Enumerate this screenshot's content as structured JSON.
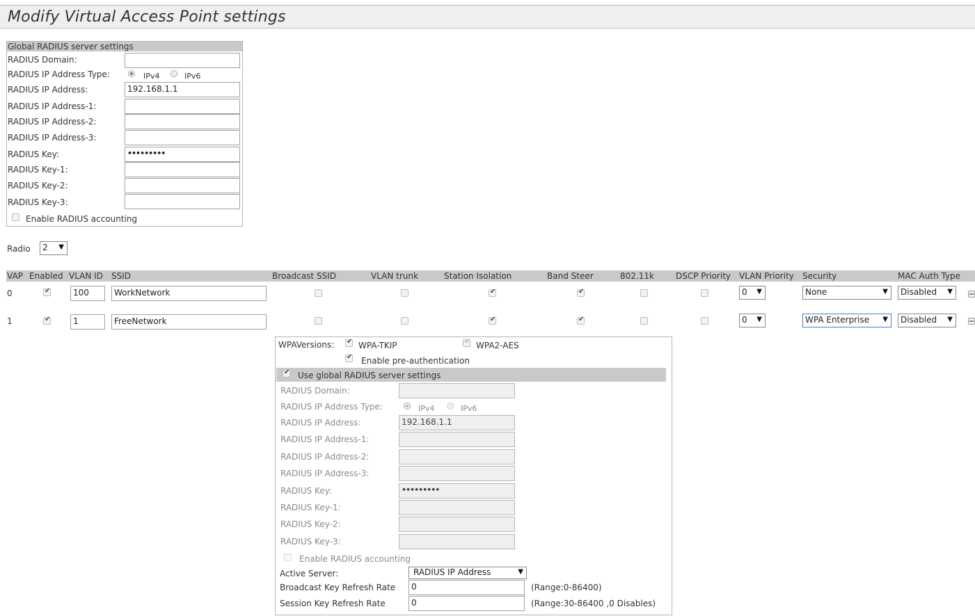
{
  "page": {
    "title": "Modify Virtual Access Point settings"
  },
  "global": {
    "header": "Global RADIUS server settings",
    "domain_label": "RADIUS Domain:",
    "domain_value": "",
    "ip_type_label": "RADIUS IP Address Type:",
    "ipv4": "IPv4",
    "ipv6": "IPv6",
    "ip_type_selected": "IPv4",
    "ip_label": "RADIUS IP Address:",
    "ip_value": "192.168.1.1",
    "ip1_label": "RADIUS IP Address-1:",
    "ip2_label": "RADIUS IP Address-2:",
    "ip3_label": "RADIUS IP Address-3:",
    "key_label": "RADIUS Key:",
    "key_value": "•••••••••",
    "key1_label": "RADIUS Key-1:",
    "key2_label": "RADIUS Key-2:",
    "key3_label": "RADIUS Key-3:",
    "accounting_label": "Enable RADIUS accounting",
    "accounting_checked": false
  },
  "radio": {
    "label": "Radio",
    "value": "2"
  },
  "table": {
    "headers": [
      "VAP",
      "Enabled",
      "VLAN ID",
      "SSID",
      "Broadcast SSID",
      "VLAN trunk",
      "Station Isolation",
      "Band Steer",
      "802.11k",
      "DSCP Priority",
      "VLAN Priority",
      "Security",
      "MAC Auth Type"
    ],
    "rows": [
      {
        "vap": "0",
        "enabled": true,
        "vlan_id": "100",
        "ssid": "WorkNetwork",
        "broadcast_ssid": false,
        "vlan_trunk": false,
        "station_isolation": true,
        "band_steer": true,
        "dot11k": false,
        "dscp_priority": false,
        "vlan_priority": "0",
        "security": "None",
        "mac_auth": "Disabled"
      },
      {
        "vap": "1",
        "enabled": true,
        "vlan_id": "1",
        "ssid": "FreeNetwork",
        "broadcast_ssid": false,
        "vlan_trunk": false,
        "station_isolation": true,
        "band_steer": true,
        "dot11k": false,
        "dscp_priority": false,
        "vlan_priority": "0",
        "security": "WPA Enterprise",
        "mac_auth": "Disabled"
      }
    ]
  },
  "wpa": {
    "versions_label": "WPAVersions:",
    "tkip_label": "WPA-TKIP",
    "aes_label": "WPA2-AES",
    "preauth_label": "Enable pre-authentication",
    "use_global_label": "Use global RADIUS server settings",
    "domain_label": "RADIUS Domain:",
    "ip_type_label": "RADIUS IP Address Type:",
    "ipv4": "IPv4",
    "ipv6": "IPv6",
    "ip_label": "RADIUS IP Address:",
    "ip_value": "192.168.1.1",
    "ip1_label": "RADIUS IP Address-1:",
    "ip2_label": "RADIUS IP Address-2:",
    "ip3_label": "RADIUS IP Address-3:",
    "key_label": "RADIUS Key:",
    "key_value": "•••••••••",
    "key1_label": "RADIUS Key-1:",
    "key2_label": "RADIUS Key-2:",
    "key3_label": "RADIUS Key-3:",
    "accounting_label": "Enable RADIUS accounting",
    "active_server_label": "Active Server:",
    "active_server_value": "RADIUS IP Address",
    "bcast_label": "Broadcast Key Refresh Rate",
    "bcast_value": "0",
    "bcast_range": "(Range:0-86400)",
    "session_label": "Session Key Refresh Rate",
    "session_value": "0",
    "session_range": "(Range:30-86400 ,0 Disables)"
  },
  "icons": {
    "row0_action": "expand-icon",
    "row1_action": "collapse-icon",
    "dropdown": "triangle-down-icon"
  }
}
